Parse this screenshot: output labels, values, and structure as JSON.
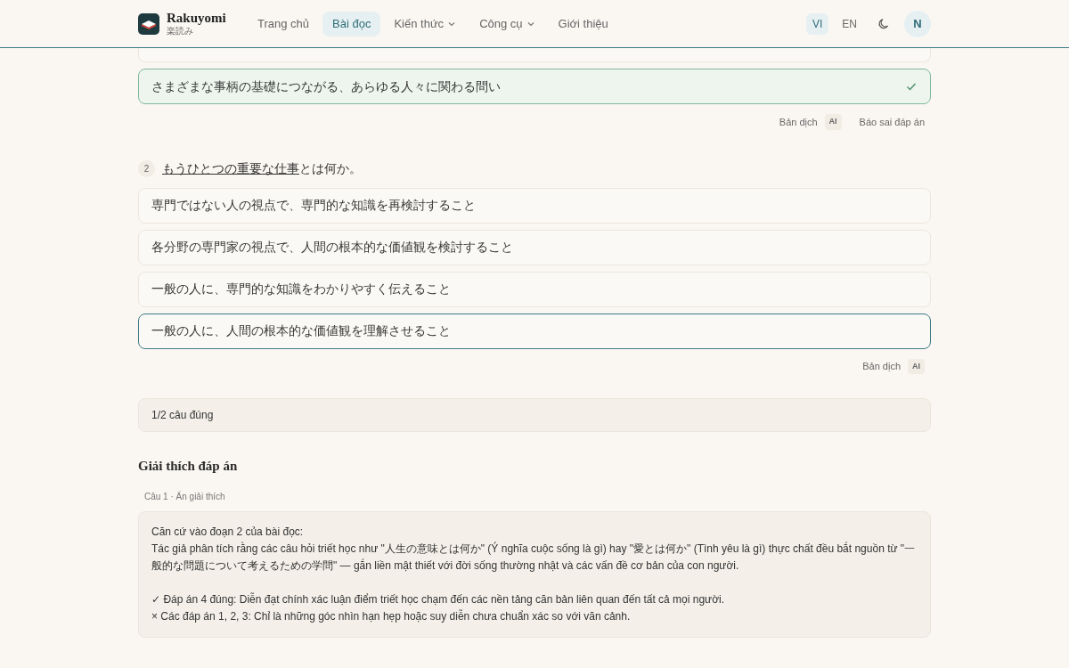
{
  "header": {
    "logo": {
      "name": "Rakuyomi",
      "sub": "楽読み"
    },
    "nav": [
      {
        "label": "Trang chủ",
        "selected": false,
        "dropdown": false
      },
      {
        "label": "Bài đọc",
        "selected": true,
        "dropdown": false
      },
      {
        "label": "Kiến thức",
        "selected": false,
        "dropdown": true
      },
      {
        "label": "Công cụ",
        "selected": false,
        "dropdown": true
      },
      {
        "label": "Giới thiệu",
        "selected": false,
        "dropdown": false
      }
    ],
    "languages": [
      {
        "label": "VI",
        "selected": true
      },
      {
        "label": "EN",
        "selected": false
      }
    ],
    "avatar": "N"
  },
  "questions": [
    {
      "options": [
        {
          "text": "さまざまな事柄の基礎につながる、あらゆる人々に関わる問い",
          "selected": true,
          "correct": true
        }
      ],
      "actions": [
        {
          "label": "Bản dịch",
          "badge": "AI"
        },
        {
          "label": "Báo sai đáp án"
        }
      ]
    },
    {
      "number": "2",
      "prompt_underlined": "もうひとつの重要な仕事",
      "prompt_rest": "とは何か。",
      "options": [
        {
          "text": "専門ではない人の視点で、専門的な知識を再検討すること",
          "selected": false,
          "correct": false
        },
        {
          "text": "各分野の専門家の視点で、人間の根本的な価値観を検討すること",
          "selected": false,
          "correct": false
        },
        {
          "text": "一般の人に、専門的な知識をわかりやすく伝えること",
          "selected": false,
          "correct": false
        },
        {
          "text": "一般の人に、人間の根本的な価値観を理解させること",
          "selected": true,
          "correct": false
        }
      ],
      "actions": [
        {
          "label": "Bản dịch",
          "badge": "AI"
        }
      ]
    }
  ],
  "result": "1/2 câu đúng",
  "explanation": {
    "title": "Giải thích đáp án",
    "toggle": "Câu 1 · Ẩn giải thích",
    "paragraphs": [
      [
        "Căn cứ vào đoạn 2 của bài đọc:",
        "Tác giả phân tích rằng các câu hỏi triết học như \"人生の意味とは何か\" (Ý nghĩa cuộc sống là gì) hay \"愛とは何か\" (Tình yêu là gì) thực chất đều bắt nguồn từ \"一般的な問題について考えるための学問\" — gắn liền mật thiết với đời sống thường nhật và các vấn đề cơ bản của con người."
      ],
      [
        "✓ Đáp án 4 đúng: Diễn đạt chính xác luận điểm triết học chạm đến các nền tảng căn bản liên quan đến tất cả mọi người.",
        "× Các đáp án 1, 2, 3: Chỉ là những góc nhìn hạn hẹp hoặc suy diễn chưa chuẩn xác so với văn cảnh."
      ]
    ]
  }
}
